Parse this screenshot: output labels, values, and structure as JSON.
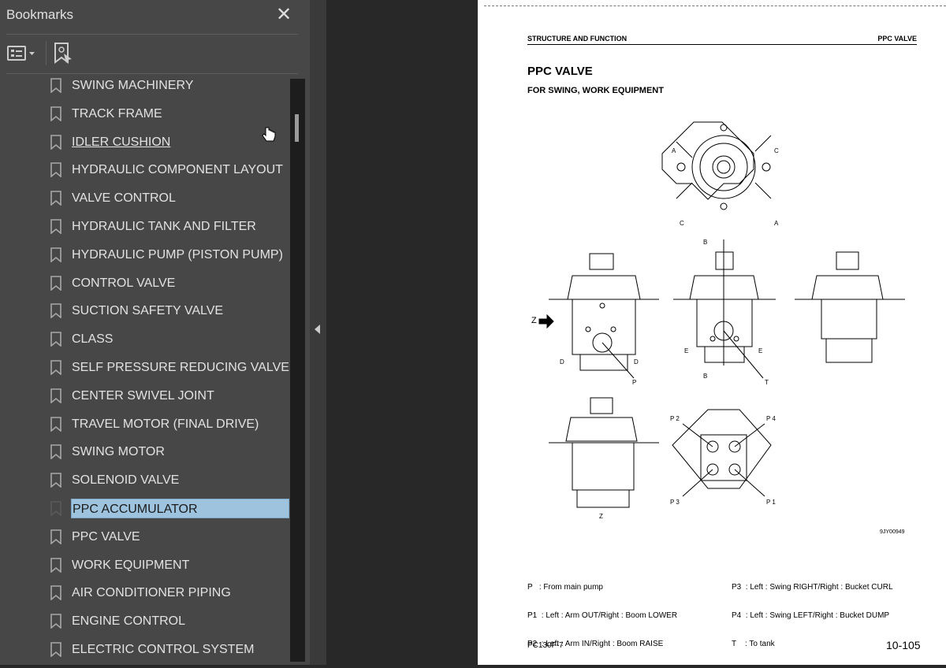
{
  "sidebar": {
    "title": "Bookmarks",
    "close_icon": "close-icon",
    "options_icon": "list-options-icon",
    "find_icon": "find-current-bookmark-icon",
    "items": [
      {
        "label": "SWING MACHINERY"
      },
      {
        "label": "TRACK FRAME"
      },
      {
        "label": "IDLER CUSHION",
        "hovered": true
      },
      {
        "label": "HYDRAULIC COMPONENT LAYOUT"
      },
      {
        "label": "VALVE CONTROL"
      },
      {
        "label": "HYDRAULIC TANK AND FILTER"
      },
      {
        "label": "HYDRAULIC PUMP (PISTON PUMP)"
      },
      {
        "label": "CONTROL VALVE"
      },
      {
        "label": "SUCTION SAFETY VALVE"
      },
      {
        "label": "CLASS"
      },
      {
        "label": "SELF PRESSURE REDUCING VALVE"
      },
      {
        "label": "CENTER SWIVEL JOINT"
      },
      {
        "label": "TRAVEL MOTOR (FINAL DRIVE)"
      },
      {
        "label": "SWING MOTOR"
      },
      {
        "label": "SOLENOID VALVE"
      },
      {
        "label": "PPC ACCUMULATOR",
        "selected": true
      },
      {
        "label": "PPC VALVE"
      },
      {
        "label": "WORK EQUIPMENT"
      },
      {
        "label": "AIR CONDITIONER PIPING"
      },
      {
        "label": "ENGINE CONTROL"
      },
      {
        "label": "ELECTRIC CONTROL SYSTEM"
      }
    ],
    "selected_color": "#9dc3df"
  },
  "page": {
    "header_left": "STRUCTURE AND FUNCTION",
    "header_right": "PPC VALVE",
    "title": "PPC VALVE",
    "subtitle": "FOR SWING, WORK EQUIPMENT",
    "diagram_labels": {
      "a": "A",
      "b": "B",
      "c": "C",
      "d": "D",
      "e": "E",
      "z": "Z",
      "p": "P",
      "t": "T",
      "p1": "P 1",
      "p2": "P 2",
      "p3": "P 3",
      "p4": "P 4",
      "code": "9JY00949"
    },
    "legend_left": [
      "P   : From main pump",
      "P1  : Left : Arm OUT/Right : Boom LOWER",
      "P2  : Left : Arm IN/Right : Boom RAISE"
    ],
    "legend_right": [
      "P3  : Left : Swing RIGHT/Right : Bucket CURL",
      "P4  : Left : Swing LEFT/Right : Bucket DUMP",
      "T    : To tank"
    ],
    "model": "PC130F-7",
    "page_number": "10-105"
  }
}
